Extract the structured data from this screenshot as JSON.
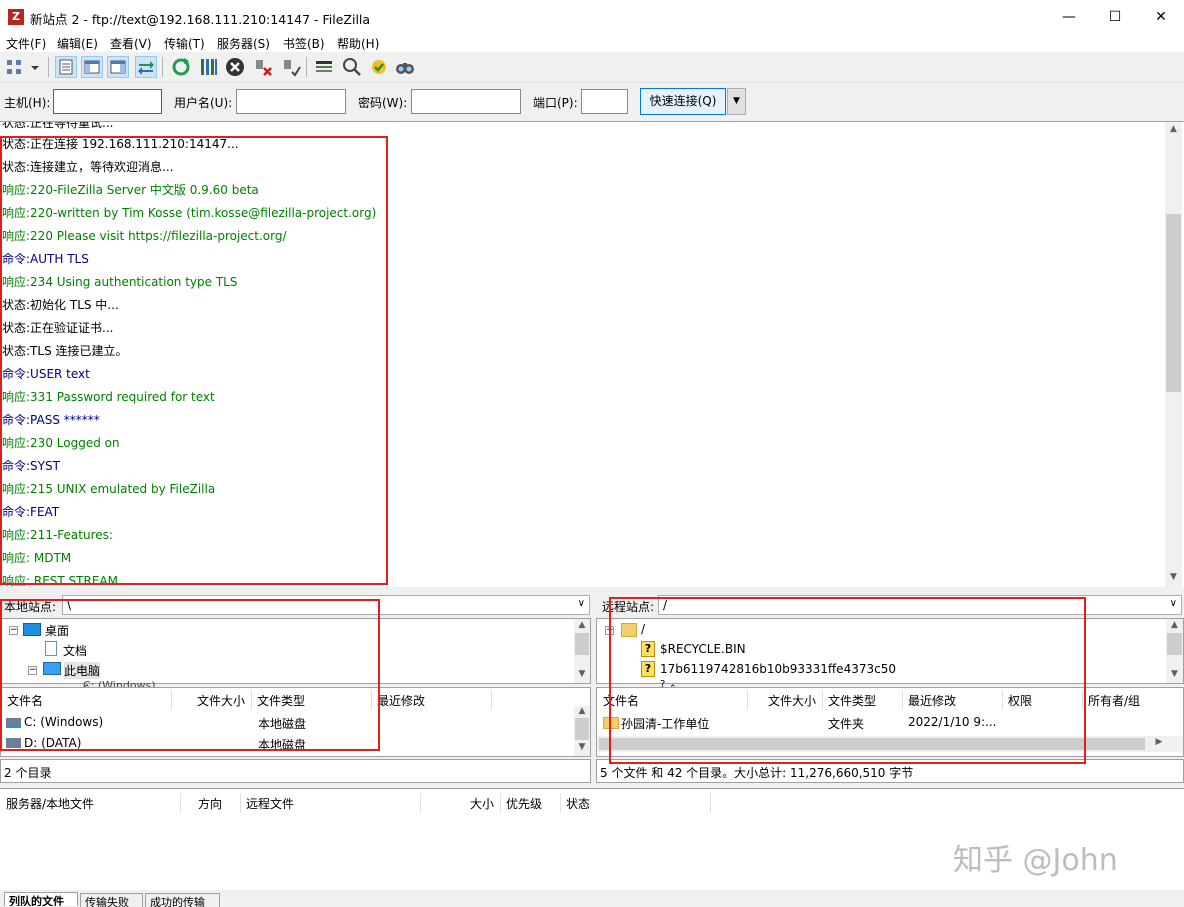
{
  "window": {
    "title": "新站点 2 - ftp://text@192.168.111.210:14147 - FileZilla",
    "app_icon_letter": "Z",
    "minimize": "—",
    "maximize": "☐",
    "close": "✕"
  },
  "menu": [
    "文件(F)",
    "编辑(E)",
    "查看(V)",
    "传输(T)",
    "服务器(S)",
    "书签(B)",
    "帮助(H)"
  ],
  "quickconnect": {
    "host_label": "主机(H):",
    "user_label": "用户名(U):",
    "pass_label": "密码(W):",
    "port_label": "端口(P):",
    "host_value": "",
    "user_value": "",
    "pass_value": "",
    "port_value": "",
    "button": "快速连接(Q)",
    "dropdown": "▼"
  },
  "log": {
    "partial_top": "状态:正在等待重试...",
    "lines": [
      {
        "prefix": "状态:",
        "text": "正在连接 192.168.111.210:14147...",
        "kind": "status"
      },
      {
        "prefix": "状态:",
        "text": "连接建立，等待欢迎消息...",
        "kind": "status"
      },
      {
        "prefix": "响应:",
        "text": "220-FileZilla Server 中文版 0.9.60 beta",
        "kind": "response"
      },
      {
        "prefix": "响应:",
        "text": "220-written by Tim Kosse (tim.kosse@filezilla-project.org)",
        "kind": "response"
      },
      {
        "prefix": "响应:",
        "text": "220 Please visit https://filezilla-project.org/",
        "kind": "response"
      },
      {
        "prefix": "命令:",
        "text": "AUTH TLS",
        "kind": "command"
      },
      {
        "prefix": "响应:",
        "text": "234 Using authentication type TLS",
        "kind": "response"
      },
      {
        "prefix": "状态:",
        "text": "初始化 TLS 中...",
        "kind": "status"
      },
      {
        "prefix": "状态:",
        "text": "正在验证证书...",
        "kind": "status"
      },
      {
        "prefix": "状态:",
        "text": "TLS 连接已建立。",
        "kind": "status"
      },
      {
        "prefix": "命令:",
        "text": "USER text",
        "kind": "command"
      },
      {
        "prefix": "响应:",
        "text": "331 Password required for text",
        "kind": "response"
      },
      {
        "prefix": "命令:",
        "text": "PASS ******",
        "kind": "command"
      },
      {
        "prefix": "响应:",
        "text": "230 Logged on",
        "kind": "response"
      },
      {
        "prefix": "命令:",
        "text": "SYST",
        "kind": "command"
      },
      {
        "prefix": "响应:",
        "text": "215 UNIX emulated by FileZilla",
        "kind": "response"
      },
      {
        "prefix": "命令:",
        "text": "FEAT",
        "kind": "command"
      },
      {
        "prefix": "响应:",
        "text": "211-Features:",
        "kind": "response"
      },
      {
        "prefix": "响应:",
        "text": " MDTM",
        "kind": "response"
      },
      {
        "prefix": "响应:",
        "text": " REST STREAM",
        "kind": "response"
      }
    ]
  },
  "local": {
    "site_label": "本地站点:",
    "path": "\\",
    "tree": [
      "桌面",
      "文档",
      "此电脑",
      "C: (Windows)"
    ],
    "columns": [
      "文件名",
      "文件大小",
      "文件类型",
      "最近修改"
    ],
    "rows": [
      {
        "name": "C: (Windows)",
        "type": "本地磁盘"
      },
      {
        "name": "D: (DATA)",
        "type": "本地磁盘"
      }
    ],
    "status": "2 个目录"
  },
  "remote": {
    "site_label": "远程站点:",
    "path": "/",
    "tree": [
      "/",
      "$RECYCLE.BIN",
      "17b6119742816b10b93331ffe4373c50",
      "?"
    ],
    "columns": [
      "文件名",
      "文件大小",
      "文件类型",
      "最近修改",
      "权限",
      "所有者/组"
    ],
    "rows": [
      {
        "name": "孙园清-工作单位",
        "type": "文件夹",
        "modified": "2022/1/10 9:..."
      }
    ],
    "status": "5 个文件 和 42 个目录。大小总计: 11,276,660,510 字节"
  },
  "queue": {
    "columns": [
      "服务器/本地文件",
      "方向",
      "远程文件",
      "大小",
      "优先级",
      "状态"
    ],
    "tabs": [
      "列队的文件",
      "传输失败",
      "成功的传输"
    ]
  },
  "watermark": "知乎 @John",
  "colors": {
    "status": "#000000",
    "response": "#008000",
    "command": "#000080",
    "highlight": "#e02020"
  }
}
